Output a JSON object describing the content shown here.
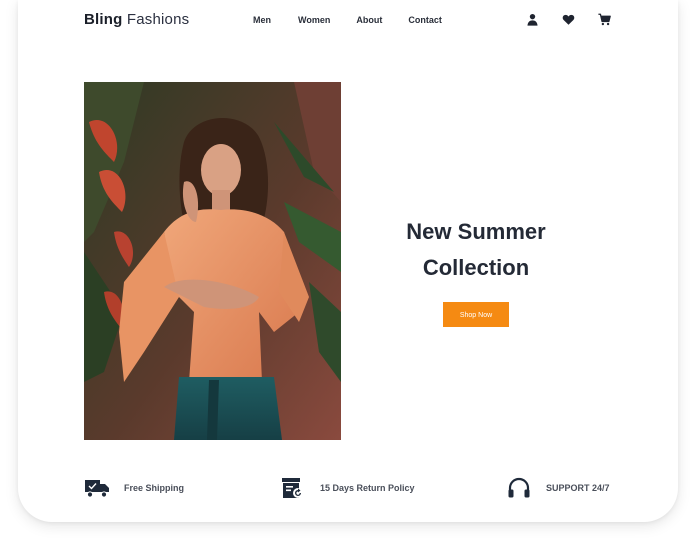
{
  "brand": {
    "bold": "Bling",
    "light": "Fashions"
  },
  "nav": {
    "items": [
      {
        "label": "Men"
      },
      {
        "label": "Women"
      },
      {
        "label": "About"
      },
      {
        "label": "Contact"
      }
    ],
    "icons": [
      "user-icon",
      "heart-icon",
      "cart-icon"
    ]
  },
  "hero": {
    "title_line1": "New Summer",
    "title_line2": "Collection",
    "button_label": "Shop Now",
    "button_color": "#f58a12",
    "image_description": "woman-in-orange-shirt-photo"
  },
  "features": [
    {
      "icon": "truck-icon",
      "label": "Free Shipping"
    },
    {
      "icon": "return-policy-icon",
      "label": "15 Days Return Policy"
    },
    {
      "icon": "headphones-icon",
      "label": "SUPPORT 24/7"
    }
  ]
}
